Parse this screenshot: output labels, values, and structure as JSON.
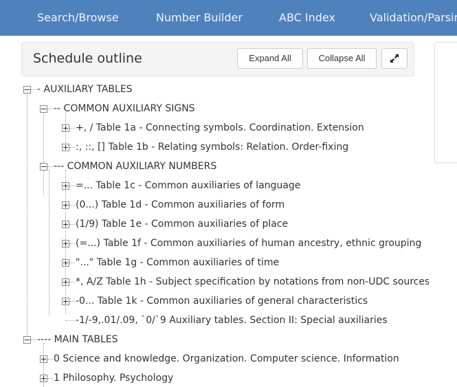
{
  "nav": {
    "items": [
      {
        "label": "Search/Browse"
      },
      {
        "label": "Number Builder"
      },
      {
        "label": "ABC Index"
      },
      {
        "label": "Validation/Parsing"
      }
    ]
  },
  "outline": {
    "title": "Schedule outline",
    "expand_all": "Expand All",
    "collapse_all": "Collapse All",
    "fullscreen_icon": "expand-arrows-icon"
  },
  "tree": {
    "aux": {
      "label": "- AUXILIARY TABLES",
      "signs": {
        "label": "-- COMMON AUXILIARY SIGNS",
        "items": [
          {
            "label": "+, / Table 1a - Connecting symbols. Coordination. Extension"
          },
          {
            "label": ":, ::, [] Table 1b - Relating symbols: Relation. Order-fixing"
          }
        ]
      },
      "numbers": {
        "label": "--- COMMON AUXILIARY NUMBERS",
        "items": [
          {
            "label": "=... Table 1c - Common auxiliaries of language"
          },
          {
            "label": "(0...) Table 1d - Common auxiliaries of form"
          },
          {
            "label": "(1/9) Table 1e - Common auxiliaries of place"
          },
          {
            "label": "(=...) Table 1f - Common auxiliaries of human ancestry, ethnic grouping"
          },
          {
            "label": "\"...\" Table 1g - Common auxiliaries of time"
          },
          {
            "label": "*, A/Z Table 1h - Subject specification by notations from non-UDC sources"
          },
          {
            "label": "-0... Table 1k - Common auxiliaries of general characteristics"
          },
          {
            "label": "-1/-9,.01/.09, `0/`9 Auxiliary tables. Section II: Special auxiliaries"
          }
        ]
      }
    },
    "main": {
      "label": "---- MAIN TABLES",
      "items": [
        {
          "label": "0 Science and knowledge. Organization. Computer science. Information"
        },
        {
          "label": "1 Philosophy. Psychology"
        }
      ]
    }
  }
}
